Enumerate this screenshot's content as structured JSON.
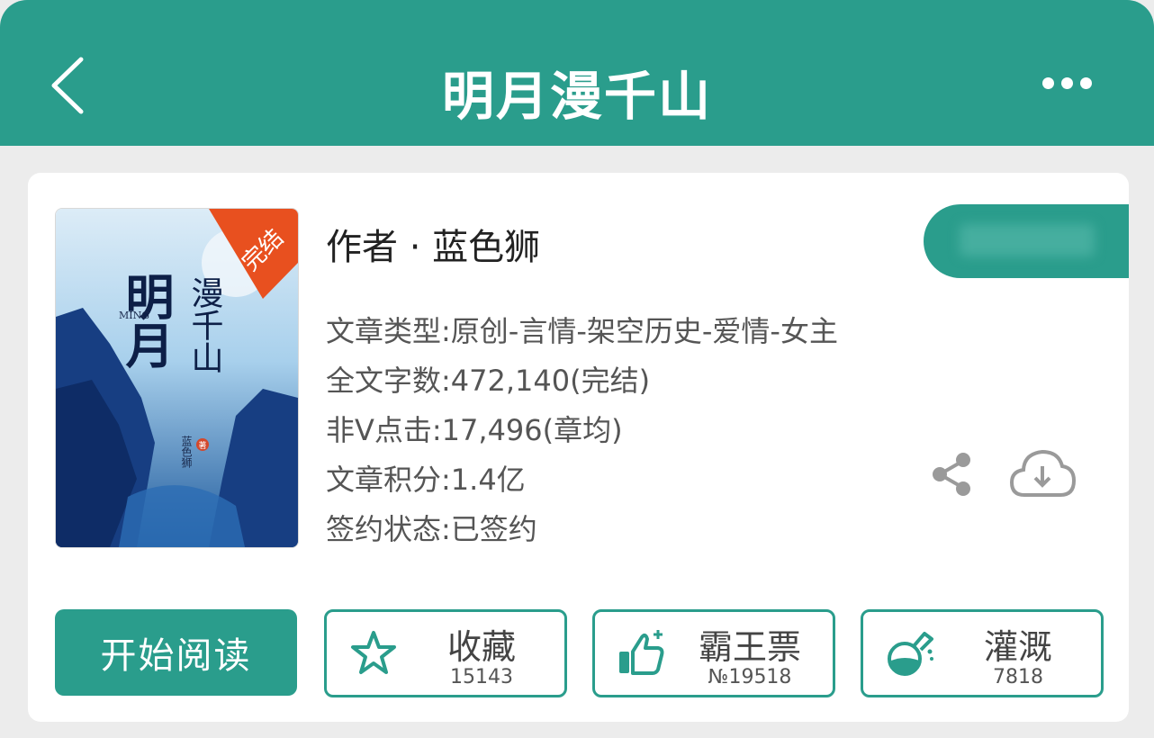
{
  "header": {
    "title": "明月漫千山"
  },
  "book": {
    "author": "作者 · 蓝色狮",
    "cover_badge": "完结",
    "cover_title_main": "明月",
    "cover_title_sub": "漫千山",
    "cover_latin": "MING",
    "cover_author_vertical": "蓝色狮",
    "cover_author_seal": "著",
    "info": [
      "文章类型:原创-言情-架空历史-爱情-女主",
      "全文字数:472,140(完结)",
      "非Ⅴ点击:17,496(章均)",
      "文章积分:1.4亿",
      "签约状态:已签约"
    ]
  },
  "actions": {
    "read_label": "开始阅读",
    "buttons": [
      {
        "label": "收藏",
        "count": "15143",
        "icon": "star-icon"
      },
      {
        "label": "霸王票",
        "count": "№19518",
        "icon": "thumbs-up-icon"
      },
      {
        "label": "灌溉",
        "count": "7818",
        "icon": "flask-icon"
      }
    ]
  },
  "colors": {
    "accent": "#2a9d8c",
    "background": "#ececec",
    "cover_badge": "#e8501f"
  }
}
